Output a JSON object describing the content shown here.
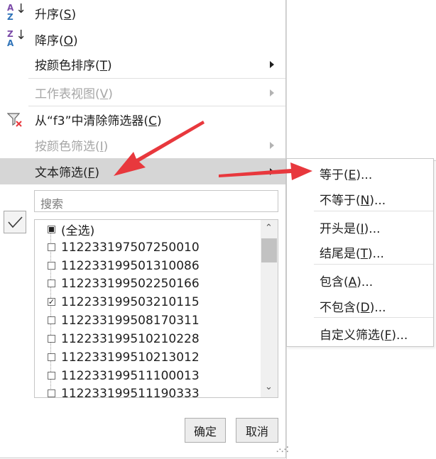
{
  "menu": {
    "items": [
      {
        "label": "升序(S)",
        "pre": "升序(",
        "key": "S",
        "post": ")"
      },
      {
        "label": "降序(O)",
        "pre": "降序(",
        "key": "O",
        "post": ")"
      },
      {
        "label": "按颜色排序(T)",
        "pre": "按颜色排序(",
        "key": "T",
        "post": ")"
      },
      {
        "label": "工作表视图(V)",
        "pre": "工作表视图(",
        "key": "V",
        "post": ")"
      },
      {
        "label": "从“f3”中清除筛选器(C)",
        "pre": "从“f3”中清除筛选器(",
        "key": "C",
        "post": ")"
      },
      {
        "label": "按颜色筛选(I)",
        "pre": "按颜色筛选(",
        "key": "I",
        "post": ")"
      },
      {
        "label": "文本筛选(F)",
        "pre": "文本筛选(",
        "key": "F",
        "post": ")"
      }
    ]
  },
  "filter": {
    "search_placeholder": "搜索",
    "items": [
      {
        "label": "(全选)",
        "state": "partial"
      },
      {
        "label": "112233197507250010",
        "state": "unchecked"
      },
      {
        "label": "112233199501310086",
        "state": "unchecked"
      },
      {
        "label": "112233199502250166",
        "state": "unchecked"
      },
      {
        "label": "112233199503210115",
        "state": "checked"
      },
      {
        "label": "112233199508170311",
        "state": "unchecked"
      },
      {
        "label": "112233199510210228",
        "state": "unchecked"
      },
      {
        "label": "112233199510213012",
        "state": "unchecked"
      },
      {
        "label": "112233199511100013",
        "state": "unchecked"
      },
      {
        "label": "112233199511190333",
        "state": "unchecked"
      }
    ],
    "ok_label": "确定",
    "cancel_label": "取消"
  },
  "submenu": {
    "items": [
      {
        "pre": "等于(",
        "key": "E",
        "post": ")..."
      },
      {
        "pre": "不等于(",
        "key": "N",
        "post": ")..."
      },
      {
        "pre": "开头是(",
        "key": "I",
        "post": ")..."
      },
      {
        "pre": "结尾是(",
        "key": "T",
        "post": ")..."
      },
      {
        "pre": "包含(",
        "key": "A",
        "post": ")..."
      },
      {
        "pre": "不包含(",
        "key": "D",
        "post": ")..."
      },
      {
        "pre": "自定义筛选(",
        "key": "F",
        "post": ")..."
      }
    ]
  },
  "colors": {
    "annotation_arrow": "#e8383d",
    "highlight": "#d6d6d6",
    "disabled": "#a6a6a6"
  }
}
